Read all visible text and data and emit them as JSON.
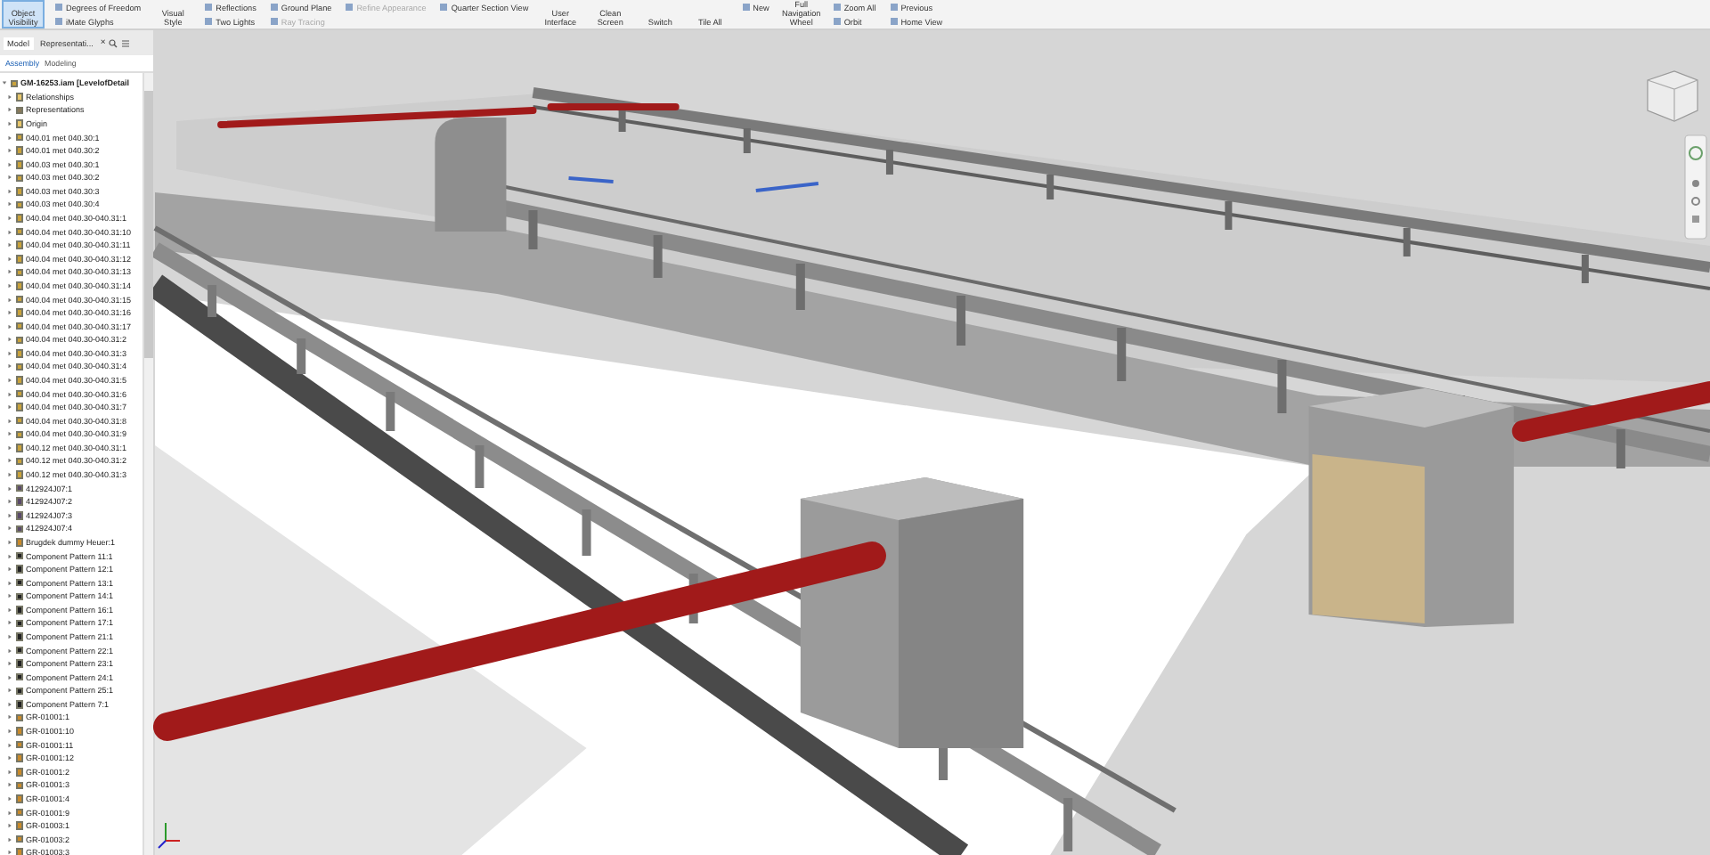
{
  "ribbon": {
    "columns": [
      {
        "items": [
          {
            "label": "Object Visibility",
            "kind": "large",
            "on": true,
            "disabled": false
          }
        ]
      },
      {
        "items": [
          {
            "label": "Degrees of Freedom",
            "kind": "small",
            "on": false,
            "disabled": false
          },
          {
            "label": "iMate Glyphs",
            "kind": "small",
            "on": false,
            "disabled": false
          }
        ]
      },
      {
        "items": [
          {
            "label": "Visual Style",
            "kind": "large",
            "on": false,
            "disabled": false
          }
        ]
      },
      {
        "items": [
          {
            "label": "Reflections",
            "kind": "small",
            "on": false,
            "disabled": false
          },
          {
            "label": "Two Lights",
            "kind": "small",
            "on": false,
            "disabled": false
          }
        ]
      },
      {
        "items": [
          {
            "label": "Ground Plane",
            "kind": "small",
            "on": false,
            "disabled": false
          },
          {
            "label": "Ray Tracing",
            "kind": "small",
            "on": false,
            "disabled": true
          }
        ]
      },
      {
        "items": [
          {
            "label": "Refine Appearance",
            "kind": "small",
            "on": false,
            "disabled": true
          }
        ]
      },
      {
        "items": [
          {
            "label": "Quarter Section View",
            "kind": "small",
            "on": false,
            "disabled": false
          }
        ]
      },
      {
        "items": [
          {
            "label": "User Interface",
            "kind": "large",
            "on": false,
            "disabled": false
          }
        ]
      },
      {
        "items": [
          {
            "label": "Clean Screen",
            "kind": "large",
            "on": false,
            "disabled": false
          }
        ]
      },
      {
        "items": [
          {
            "label": "Switch",
            "kind": "large",
            "on": false,
            "disabled": false
          }
        ]
      },
      {
        "items": [
          {
            "label": "Tile All",
            "kind": "large",
            "on": false,
            "disabled": false
          }
        ]
      },
      {
        "items": [
          {
            "label": "New",
            "kind": "small",
            "on": false,
            "disabled": false
          }
        ]
      },
      {
        "items": [
          {
            "label": "Full Navigation Wheel",
            "kind": "large",
            "on": false,
            "disabled": false
          }
        ]
      },
      {
        "items": [
          {
            "label": "Zoom All",
            "kind": "small",
            "on": false,
            "disabled": false
          },
          {
            "label": "Orbit",
            "kind": "small",
            "on": false,
            "disabled": false
          }
        ]
      },
      {
        "items": [
          {
            "label": "Previous",
            "kind": "small",
            "on": false,
            "disabled": false
          },
          {
            "label": "Home View",
            "kind": "small",
            "on": false,
            "disabled": false
          }
        ]
      }
    ]
  },
  "browser": {
    "tabs": [
      {
        "label": "Model",
        "selected": true
      },
      {
        "label": "Representati...",
        "selected": false
      }
    ],
    "close": "×",
    "subtabs": [
      {
        "label": "Assembly",
        "selected": true
      },
      {
        "label": "Modeling",
        "selected": false
      }
    ],
    "tree": [
      {
        "label": "GM-16253.iam [LevelofDetail",
        "kind": "assembly",
        "expanded": true,
        "children": [
          {
            "label": "Relationships",
            "kind": "folder",
            "expanded": false
          },
          {
            "label": "Representations",
            "kind": "representations",
            "expanded": false
          },
          {
            "label": "Origin",
            "kind": "folder",
            "expanded": false
          },
          {
            "label": "040.01 met 040.30:1",
            "kind": "part",
            "expanded": false
          },
          {
            "label": "040.01 met 040.30:2",
            "kind": "part",
            "expanded": false
          },
          {
            "label": "040.03 met 040.30:1",
            "kind": "part",
            "expanded": false
          },
          {
            "label": "040.03 met 040.30:2",
            "kind": "part",
            "expanded": false
          },
          {
            "label": "040.03 met 040.30:3",
            "kind": "part",
            "expanded": false
          },
          {
            "label": "040.03 met 040.30:4",
            "kind": "part",
            "expanded": false
          },
          {
            "label": "040.04 met 040.30-040.31:1",
            "kind": "part",
            "expanded": false
          },
          {
            "label": "040.04 met 040.30-040.31:10",
            "kind": "part",
            "expanded": false
          },
          {
            "label": "040.04 met 040.30-040.31:11",
            "kind": "part",
            "expanded": false
          },
          {
            "label": "040.04 met 040.30-040.31:12",
            "kind": "part",
            "expanded": false
          },
          {
            "label": "040.04 met 040.30-040.31:13",
            "kind": "part",
            "expanded": false
          },
          {
            "label": "040.04 met 040.30-040.31:14",
            "kind": "part",
            "expanded": false
          },
          {
            "label": "040.04 met 040.30-040.31:15",
            "kind": "part",
            "expanded": false
          },
          {
            "label": "040.04 met 040.30-040.31:16",
            "kind": "part",
            "expanded": false
          },
          {
            "label": "040.04 met 040.30-040.31:17",
            "kind": "part",
            "expanded": false
          },
          {
            "label": "040.04 met 040.30-040.31:2",
            "kind": "part",
            "expanded": false
          },
          {
            "label": "040.04 met 040.30-040.31:3",
            "kind": "part",
            "expanded": false
          },
          {
            "label": "040.04 met 040.30-040.31:4",
            "kind": "part",
            "expanded": false
          },
          {
            "label": "040.04 met 040.30-040.31:5",
            "kind": "part",
            "expanded": false
          },
          {
            "label": "040.04 met 040.30-040.31:6",
            "kind": "part",
            "expanded": false
          },
          {
            "label": "040.04 met 040.30-040.31:7",
            "kind": "part",
            "expanded": false
          },
          {
            "label": "040.04 met 040.30-040.31:8",
            "kind": "part",
            "expanded": false
          },
          {
            "label": "040.04 met 040.30-040.31:9",
            "kind": "part",
            "expanded": false
          },
          {
            "label": "040.12 met 040.30-040.31:1",
            "kind": "part",
            "expanded": false
          },
          {
            "label": "040.12 met 040.30-040.31:2",
            "kind": "part",
            "expanded": false
          },
          {
            "label": "040.12 met 040.30-040.31:3",
            "kind": "part",
            "expanded": false
          },
          {
            "label": "412924J07:1",
            "kind": "subassembly",
            "expanded": false
          },
          {
            "label": "412924J07:2",
            "kind": "subassembly",
            "expanded": false
          },
          {
            "label": "412924J07:3",
            "kind": "subassembly",
            "expanded": false
          },
          {
            "label": "412924J07:4",
            "kind": "subassembly",
            "expanded": false
          },
          {
            "label": "Brugdek dummy Heuer:1",
            "kind": "weldment",
            "expanded": false
          },
          {
            "label": "Component Pattern 11:1",
            "kind": "pattern",
            "expanded": false
          },
          {
            "label": "Component Pattern 12:1",
            "kind": "pattern",
            "expanded": false
          },
          {
            "label": "Component Pattern 13:1",
            "kind": "pattern",
            "expanded": false
          },
          {
            "label": "Component Pattern 14:1",
            "kind": "pattern",
            "expanded": false
          },
          {
            "label": "Component Pattern 16:1",
            "kind": "pattern",
            "expanded": false
          },
          {
            "label": "Component Pattern 17:1",
            "kind": "pattern",
            "expanded": false
          },
          {
            "label": "Component Pattern 21:1",
            "kind": "pattern",
            "expanded": false
          },
          {
            "label": "Component Pattern 22:1",
            "kind": "pattern",
            "expanded": false
          },
          {
            "label": "Component Pattern 23:1",
            "kind": "pattern",
            "expanded": false
          },
          {
            "label": "Component Pattern 24:1",
            "kind": "pattern",
            "expanded": false
          },
          {
            "label": "Component Pattern 25:1",
            "kind": "pattern",
            "expanded": false
          },
          {
            "label": "Component Pattern 7:1",
            "kind": "pattern",
            "expanded": false
          },
          {
            "label": "GR-01001:1",
            "kind": "weldment",
            "expanded": false
          },
          {
            "label": "GR-01001:10",
            "kind": "weldment",
            "expanded": false
          },
          {
            "label": "GR-01001:11",
            "kind": "weldment",
            "expanded": false
          },
          {
            "label": "GR-01001:12",
            "kind": "weldment",
            "expanded": false
          },
          {
            "label": "GR-01001:2",
            "kind": "weldment",
            "expanded": false
          },
          {
            "label": "GR-01001:3",
            "kind": "weldment",
            "expanded": false
          },
          {
            "label": "GR-01001:4",
            "kind": "weldment",
            "expanded": false
          },
          {
            "label": "GR-01001:9",
            "kind": "weldment",
            "expanded": false
          },
          {
            "label": "GR-01003:1",
            "kind": "weldment",
            "expanded": false
          },
          {
            "label": "GR-01003:2",
            "kind": "weldment",
            "expanded": false
          },
          {
            "label": "GR-01003:3",
            "kind": "weldment",
            "expanded": false
          }
        ]
      }
    ]
  }
}
